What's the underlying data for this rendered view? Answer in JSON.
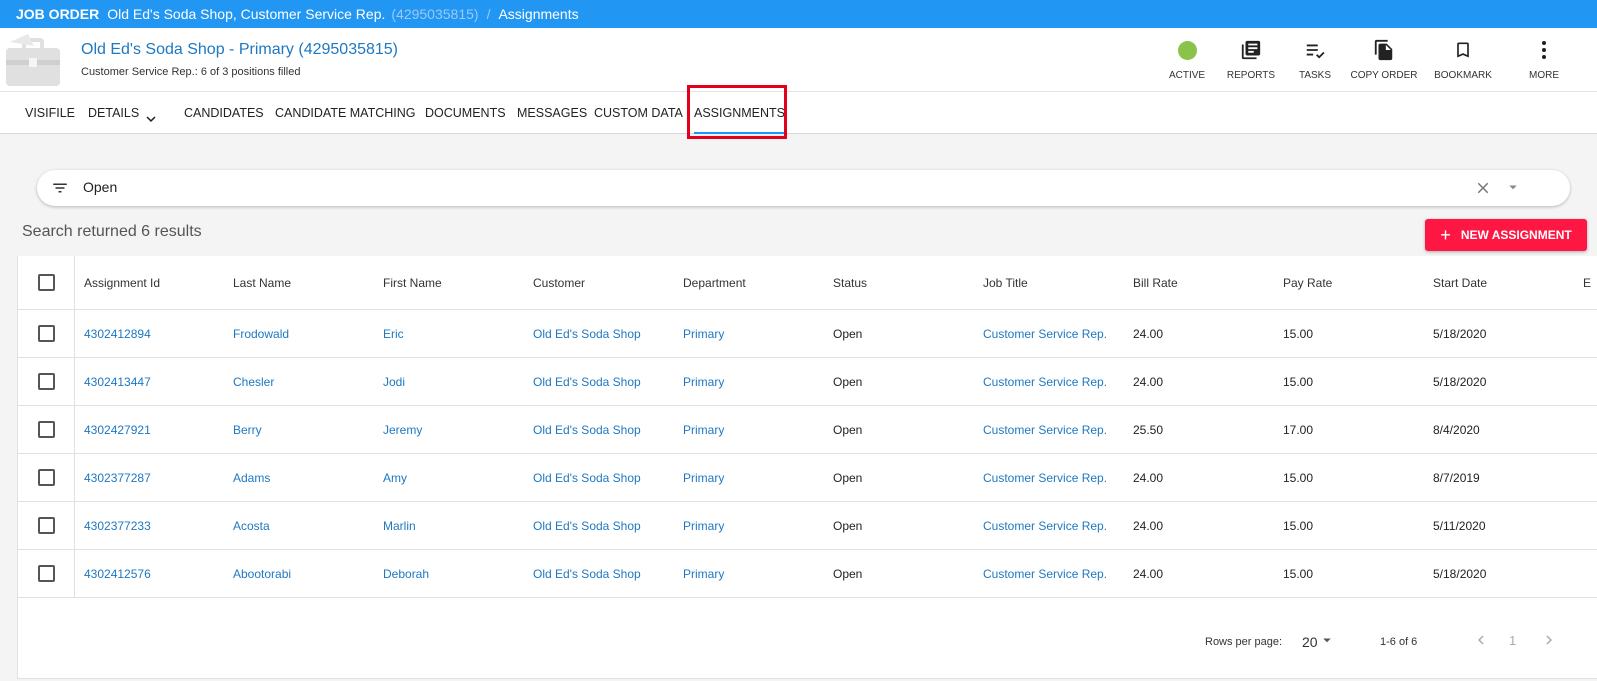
{
  "topbar": {
    "label": "JOB ORDER",
    "job_name": "Old Ed's Soda Shop, Customer Service Rep.",
    "job_id": "(4295035815)",
    "separator": "/",
    "section": "Assignments"
  },
  "header": {
    "title": "Old Ed's Soda Shop - Primary (4295035815)",
    "subtitle": "Customer Service Rep.: 6 of 3 positions filled",
    "status_color": "#8bc34a",
    "actions": [
      {
        "label": "ACTIVE",
        "icon": "status-dot-icon"
      },
      {
        "label": "REPORTS",
        "icon": "reports-icon"
      },
      {
        "label": "TASKS",
        "icon": "tasks-icon"
      },
      {
        "label": "COPY ORDER",
        "icon": "copy-icon"
      },
      {
        "label": "BOOKMARK",
        "icon": "bookmark-icon"
      },
      {
        "label": "MORE",
        "icon": "more-vertical-icon"
      }
    ]
  },
  "tabs": [
    {
      "label": "VISIFILE"
    },
    {
      "label": "DETAILS",
      "icon": "chevron-down-icon"
    },
    {
      "label": "CANDIDATES"
    },
    {
      "label": "CANDIDATE MATCHING"
    },
    {
      "label": "DOCUMENTS"
    },
    {
      "label": "MESSAGES"
    },
    {
      "label": "CUSTOM DATA"
    },
    {
      "label": "ASSIGNMENTS",
      "active": true
    }
  ],
  "filter": {
    "value": "Open",
    "icon": "filter-icon"
  },
  "results_text": "Search returned 6 results",
  "new_button": {
    "icon": "plus-icon",
    "label": "NEW ASSIGNMENT",
    "color": "#ff1744"
  },
  "table": {
    "columns": [
      "Assignment Id",
      "Last Name",
      "First Name",
      "Customer",
      "Department",
      "Status",
      "Job Title",
      "Bill Rate",
      "Pay Rate",
      "Start Date",
      "E"
    ],
    "rows": [
      [
        "4302412894",
        "Frodowald",
        "Eric",
        "Old Ed's Soda Shop",
        "Primary",
        "Open",
        "Customer Service Rep.",
        "24.00",
        "15.00",
        "5/18/2020"
      ],
      [
        "4302413447",
        "Chesler",
        "Jodi",
        "Old Ed's Soda Shop",
        "Primary",
        "Open",
        "Customer Service Rep.",
        "24.00",
        "15.00",
        "5/18/2020"
      ],
      [
        "4302427921",
        "Berry",
        "Jeremy",
        "Old Ed's Soda Shop",
        "Primary",
        "Open",
        "Customer Service Rep.",
        "25.50",
        "17.00",
        "8/4/2020"
      ],
      [
        "4302377287",
        "Adams",
        "Amy",
        "Old Ed's Soda Shop",
        "Primary",
        "Open",
        "Customer Service Rep.",
        "24.00",
        "15.00",
        "8/7/2019"
      ],
      [
        "4302377233",
        "Acosta",
        "Marlin",
        "Old Ed's Soda Shop",
        "Primary",
        "Open",
        "Customer Service Rep.",
        "24.00",
        "15.00",
        "5/11/2020"
      ],
      [
        "4302412576",
        "Abootorabi",
        "Deborah",
        "Old Ed's Soda Shop",
        "Primary",
        "Open",
        "Customer Service Rep.",
        "24.00",
        "15.00",
        "5/18/2020"
      ]
    ]
  },
  "pagination": {
    "rows_per_page_label": "Rows per page:",
    "rows_per_page": "20",
    "range": "1-6 of 6",
    "page": "1"
  },
  "colors": {
    "topbar": "#2196f3",
    "link": "#1e78c2",
    "tab_highlight": "#e3001b"
  }
}
